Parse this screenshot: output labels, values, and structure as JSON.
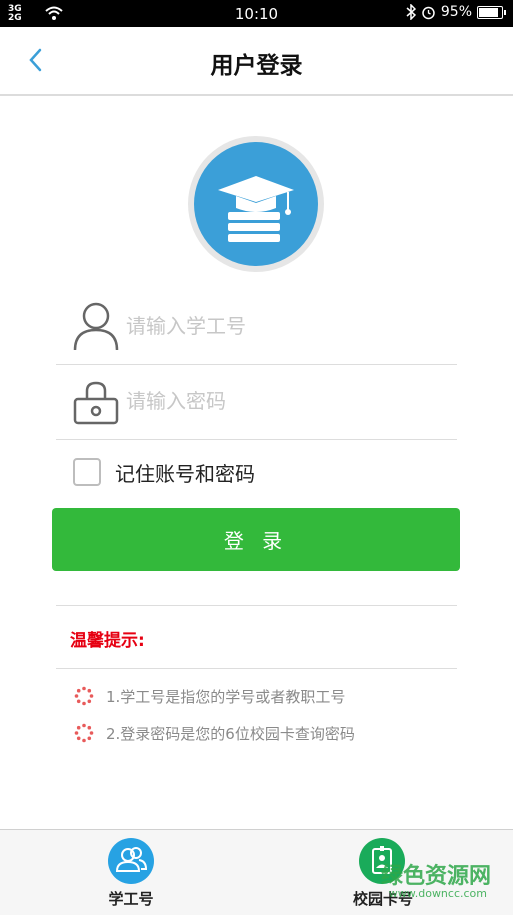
{
  "status_bar": {
    "signal": "3G\n2G",
    "time": "10:10",
    "battery": "95%",
    "battery_level": 0.95
  },
  "header": {
    "title": "用户登录"
  },
  "form": {
    "username_placeholder": "请输入学工号",
    "username_value": "",
    "password_placeholder": "请输入密码",
    "password_value": "",
    "remember_label": "记住账号和密码",
    "remember_checked": false,
    "login_label": "登 录"
  },
  "tips": {
    "title": "温馨提示:",
    "items": [
      "1.学工号是指您的学号或者教职工号",
      "2.登录密码是您的6位校园卡查询密码"
    ]
  },
  "tabbar": {
    "tabs": [
      {
        "label": "学工号",
        "color": "#27a2e3"
      },
      {
        "label": "校园卡号",
        "color": "#1aab5a"
      }
    ]
  },
  "watermark": {
    "text": "绿色资源网",
    "url": "www.downcc.com"
  },
  "colors": {
    "accent_blue": "#3b9fd8",
    "login_green": "#33b93b",
    "tip_red": "#e60012"
  }
}
